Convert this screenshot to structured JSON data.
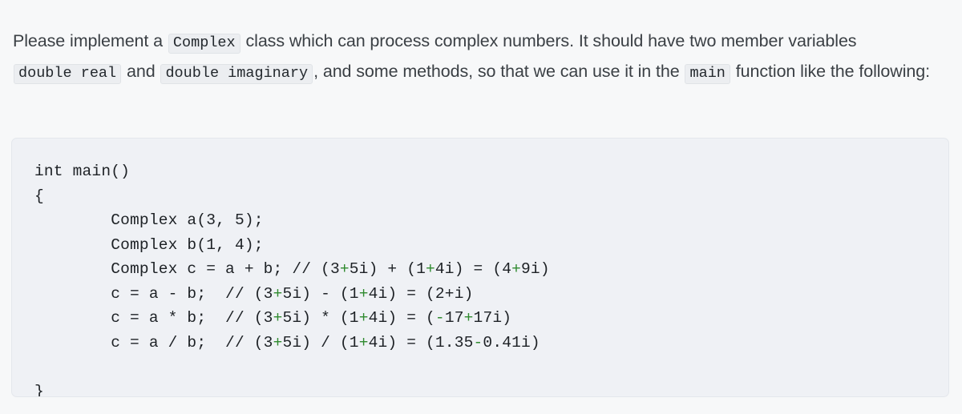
{
  "prose": {
    "segments": [
      {
        "kind": "text",
        "value": "Please implement a "
      },
      {
        "kind": "code",
        "value": "Complex"
      },
      {
        "kind": "text",
        "value": " class which can process complex numbers. It should have two member variables "
      },
      {
        "kind": "code",
        "value": "double real"
      },
      {
        "kind": "text",
        "value": " and "
      },
      {
        "kind": "code",
        "value": "double imaginary"
      },
      {
        "kind": "text",
        "value": ", and some methods, so that we can use it in the "
      },
      {
        "kind": "code",
        "value": "main"
      },
      {
        "kind": "text",
        "value": " function like the following:"
      }
    ]
  },
  "code_block": {
    "language": "cpp",
    "comment_operator_color": "#2f8a2f",
    "text_color": "#1d2125",
    "background": "#eff1f5",
    "lines": [
      [
        {
          "t": "int main()"
        }
      ],
      [
        {
          "t": "{"
        }
      ],
      [
        {
          "t": "        Complex a(3, 5);"
        }
      ],
      [
        {
          "t": "        Complex b(1, 4);"
        }
      ],
      [
        {
          "t": "        Complex c = a + b; // (3"
        },
        {
          "t": "+",
          "c": "green"
        },
        {
          "t": "5i) + (1"
        },
        {
          "t": "+",
          "c": "green"
        },
        {
          "t": "4i) = (4"
        },
        {
          "t": "+",
          "c": "green"
        },
        {
          "t": "9i)"
        }
      ],
      [
        {
          "t": "        c = a - b;  // (3"
        },
        {
          "t": "+",
          "c": "green"
        },
        {
          "t": "5i) - (1"
        },
        {
          "t": "+",
          "c": "green"
        },
        {
          "t": "4i) = (2+i)"
        }
      ],
      [
        {
          "t": "        c = a * b;  // (3"
        },
        {
          "t": "+",
          "c": "green"
        },
        {
          "t": "5i) * (1"
        },
        {
          "t": "+",
          "c": "green"
        },
        {
          "t": "4i) = ("
        },
        {
          "t": "-",
          "c": "green"
        },
        {
          "t": "17"
        },
        {
          "t": "+",
          "c": "green"
        },
        {
          "t": "17i)"
        }
      ],
      [
        {
          "t": "        c = a / b;  // (3"
        },
        {
          "t": "+",
          "c": "green"
        },
        {
          "t": "5i) / (1"
        },
        {
          "t": "+",
          "c": "green"
        },
        {
          "t": "4i) = (1.35"
        },
        {
          "t": "-",
          "c": "green"
        },
        {
          "t": "0.41i)"
        }
      ],
      [
        {
          "t": ""
        }
      ],
      [
        {
          "t": "}"
        }
      ]
    ]
  }
}
